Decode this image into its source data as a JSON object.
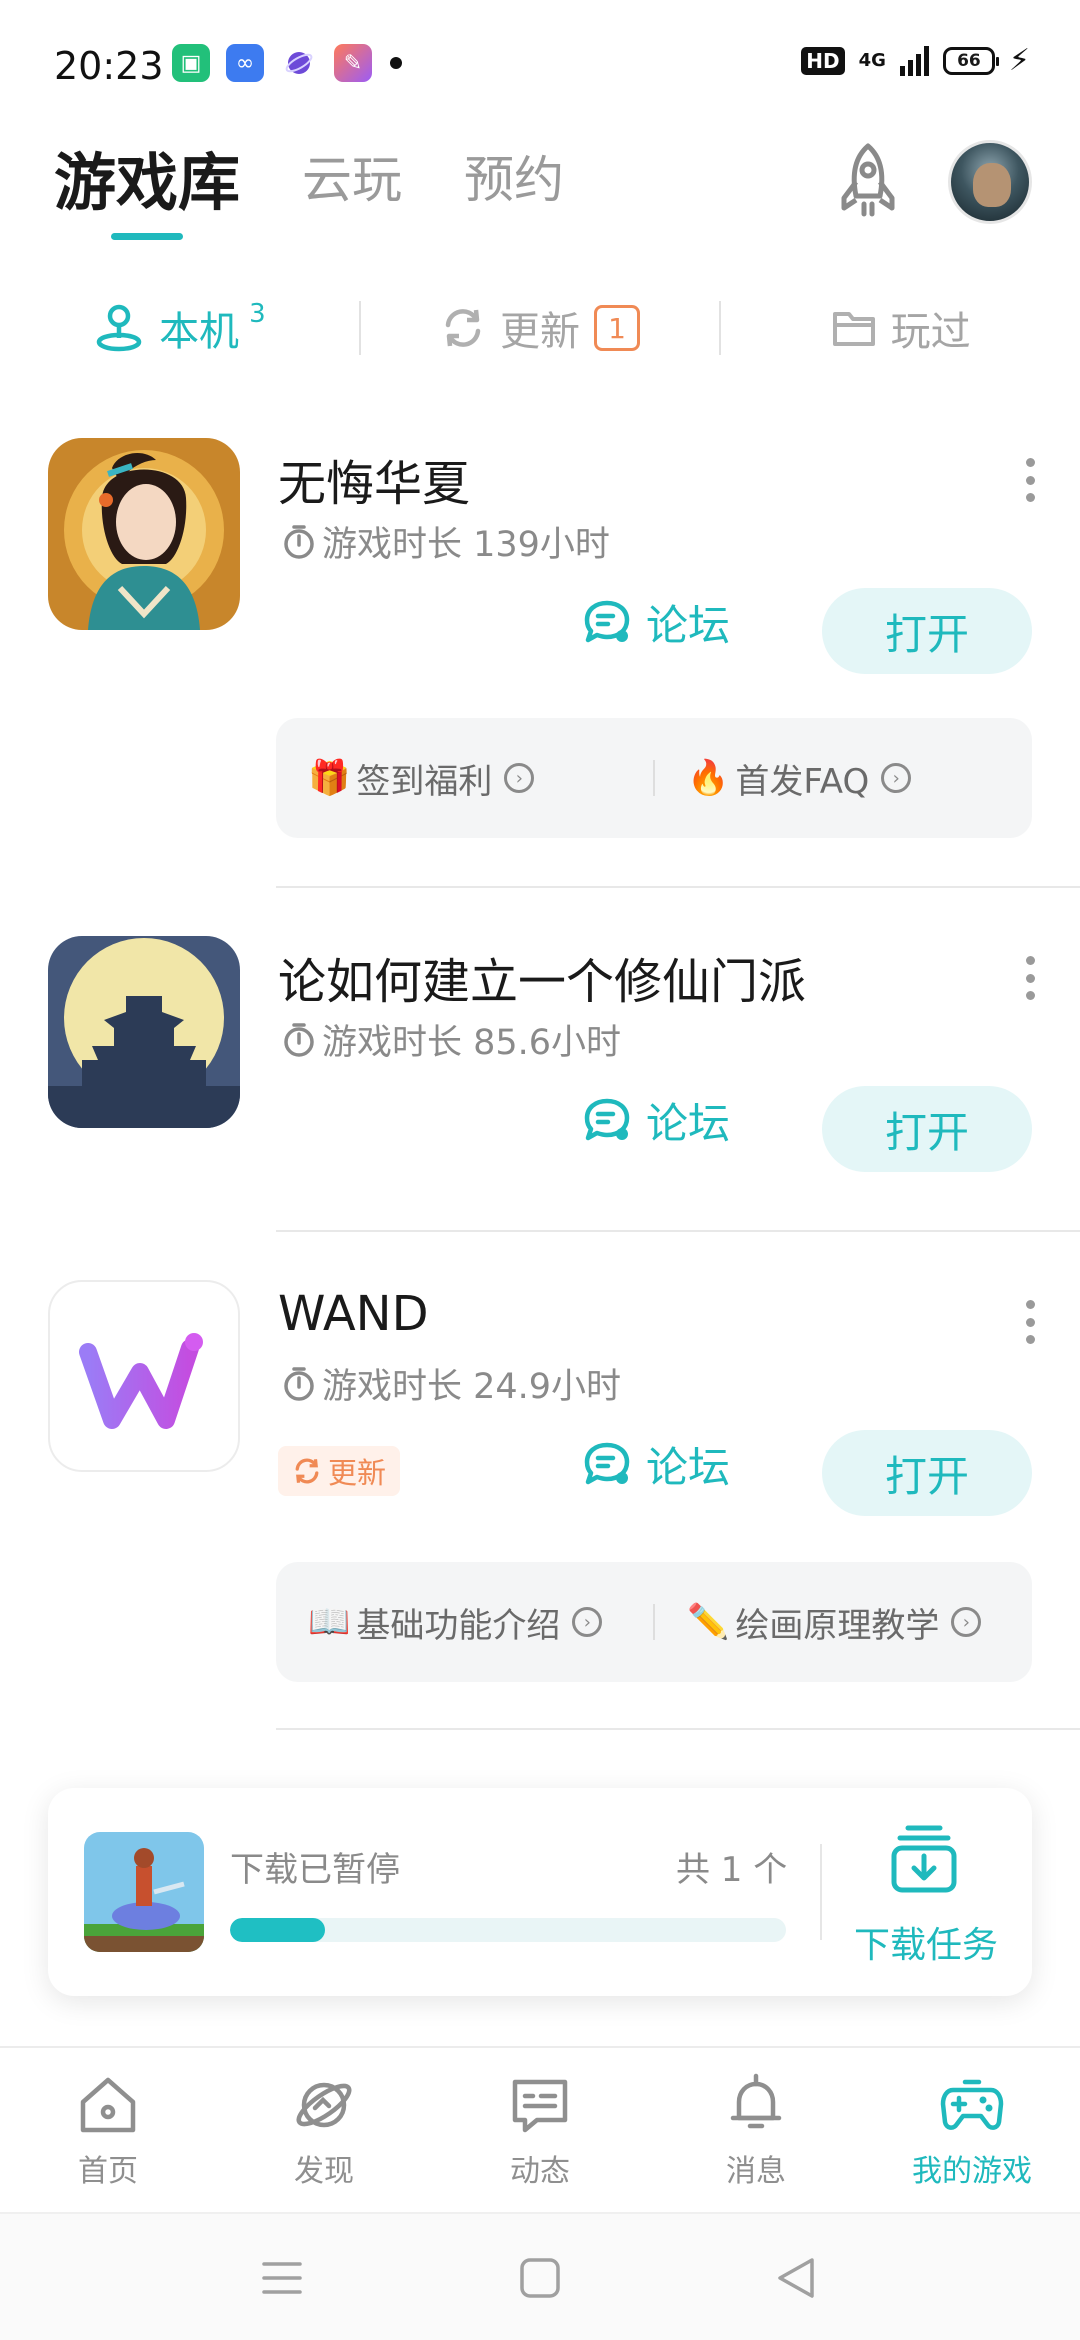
{
  "status_bar": {
    "time": "20:23",
    "hd": "HD",
    "network": "4G",
    "battery": "66",
    "notification_icons": [
      "app-store-icon",
      "loop-icon",
      "orbit-icon",
      "pen-app-icon"
    ]
  },
  "header": {
    "tabs": [
      {
        "label": "游戏库",
        "active": true
      },
      {
        "label": "云玩",
        "active": false
      },
      {
        "label": "预约",
        "active": false
      }
    ]
  },
  "filters": {
    "local": {
      "label": "本机",
      "count": "3"
    },
    "update": {
      "label": "更新",
      "badge": "1"
    },
    "played": {
      "label": "玩过"
    }
  },
  "games": [
    {
      "title": "无悔华夏",
      "playtime": "游戏时长 139小时",
      "forum": "论坛",
      "open": "打开",
      "links": [
        {
          "icon": "gift-icon",
          "text": "签到福利"
        },
        {
          "icon": "fire-icon",
          "text": "首发FAQ"
        }
      ]
    },
    {
      "title": "论如何建立一个修仙门派",
      "playtime": "游戏时长 85.6小时",
      "forum": "论坛",
      "open": "打开"
    },
    {
      "title": "WAND",
      "playtime": "游戏时长 24.9小时",
      "update_tag": "更新",
      "forum": "论坛",
      "open": "打开",
      "links": [
        {
          "icon": "book-icon",
          "text": "基础功能介绍"
        },
        {
          "icon": "pencil-icon",
          "text": "绘画原理教学"
        }
      ]
    }
  ],
  "download": {
    "status": "下载已暂停",
    "total": "共 1 个",
    "progress": 0.17,
    "task_label": "下载任务"
  },
  "bottom_nav": [
    {
      "label": "首页",
      "icon": "home-icon",
      "active": false
    },
    {
      "label": "发现",
      "icon": "planet-icon",
      "active": false
    },
    {
      "label": "动态",
      "icon": "chat-icon",
      "active": false
    },
    {
      "label": "消息",
      "icon": "bell-icon",
      "active": false
    },
    {
      "label": "我的游戏",
      "icon": "gamepad-icon",
      "active": true
    }
  ],
  "colors": {
    "accent": "#1fb9bd",
    "update_orange": "#f08a55",
    "open_button_bg": "#e4f6f7"
  }
}
